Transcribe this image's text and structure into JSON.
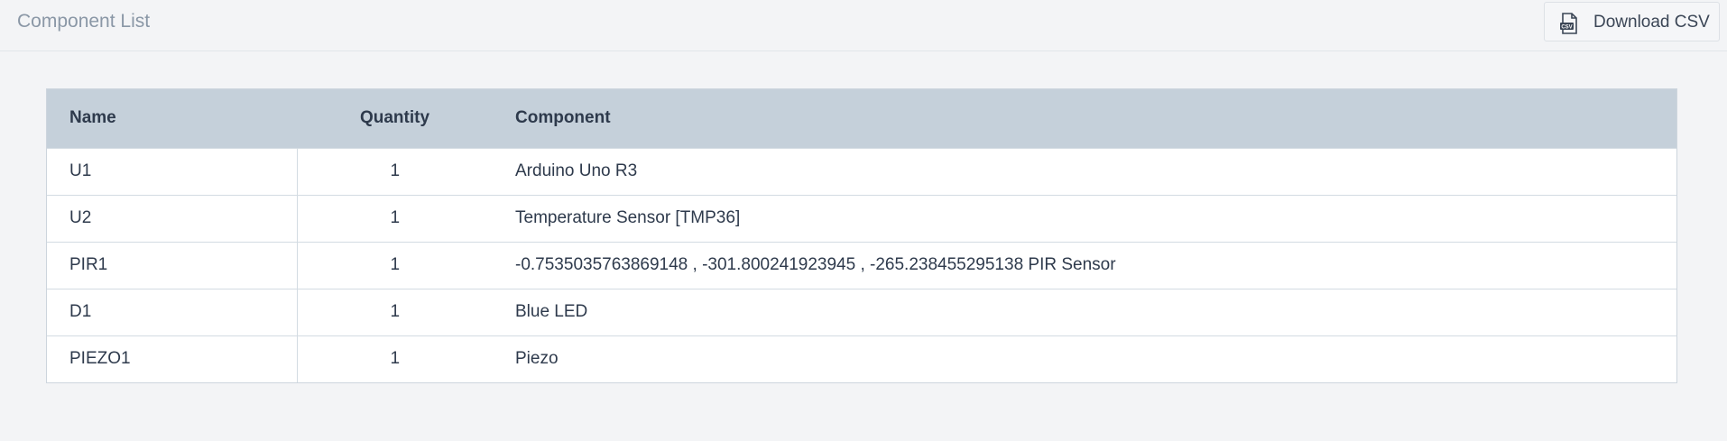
{
  "header": {
    "title": "Component List",
    "download_label": "Download CSV",
    "download_icon": "csv-file-icon"
  },
  "table": {
    "columns": [
      "Name",
      "Quantity",
      "Component"
    ],
    "rows": [
      {
        "name": "U1",
        "quantity": "1",
        "component": "Arduino Uno R3"
      },
      {
        "name": "U2",
        "quantity": "1",
        "component": "Temperature Sensor [TMP36]"
      },
      {
        "name": "PIR1",
        "quantity": "1",
        "component": "-0.7535035763869148 , -301.800241923945 , -265.238455295138 PIR Sensor"
      },
      {
        "name": "D1",
        "quantity": "1",
        "component": "Blue LED"
      },
      {
        "name": "PIEZO1",
        "quantity": "1",
        "component": "Piezo"
      }
    ]
  }
}
